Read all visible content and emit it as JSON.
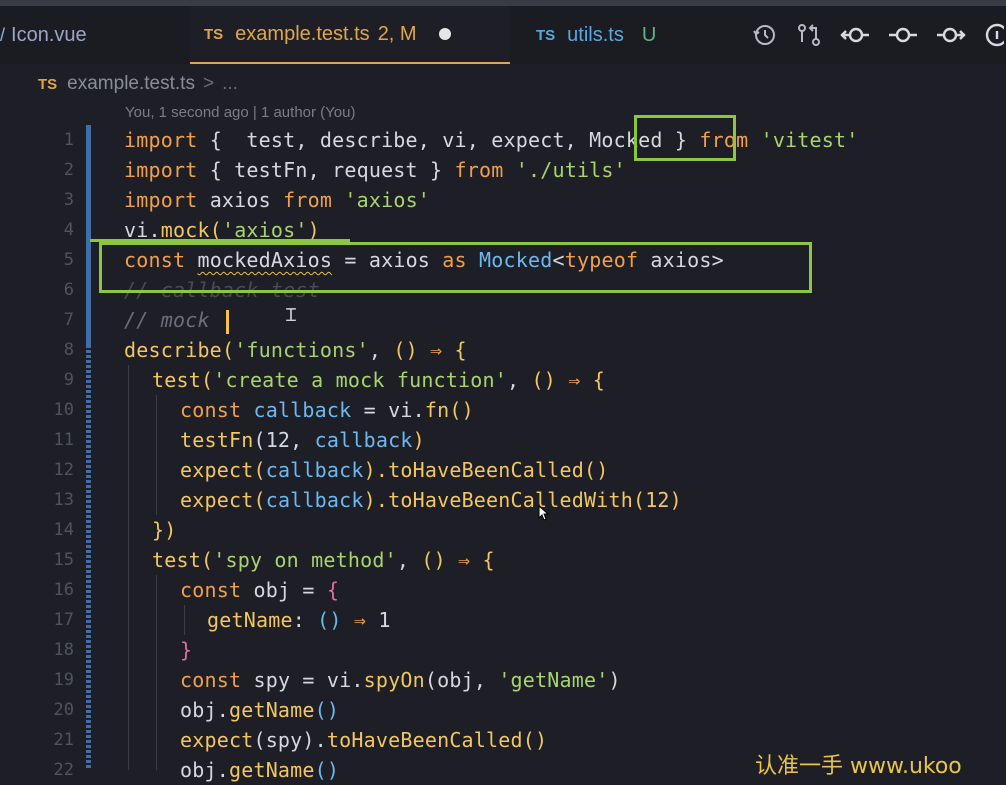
{
  "tabs": [
    {
      "label": "Icon.vue",
      "prefix": "",
      "status": "",
      "color": "#8ab4e8"
    },
    {
      "label": "example.test.ts",
      "prefix": "TS",
      "status": "2, M",
      "color": "#e0a64a",
      "active": true
    },
    {
      "label": "utils.ts",
      "prefix": "TS",
      "status": "U",
      "color": "#5aa7e0"
    }
  ],
  "tab_icons": [
    "history-icon",
    "git-compare-icon",
    "commit-prev-icon",
    "commit-icon",
    "commit-next-icon",
    "info-icon"
  ],
  "breadcrumb": {
    "prefix": "TS",
    "file": "example.test.ts",
    "sep": ">",
    "rest": "..."
  },
  "blame": "You, 1 second ago | 1 author (You)",
  "line_numbers": [
    "1",
    "2",
    "3",
    "4",
    "5",
    "6",
    "7",
    "8",
    "9",
    "10",
    "11",
    "12",
    "13",
    "14",
    "15",
    "16",
    "17",
    "18",
    "19",
    "20",
    "21",
    "22"
  ],
  "code": {
    "l1": {
      "a": "import",
      "b": " {  test, describe, vi, expect, ",
      "c": "Mocked",
      "d": " } ",
      "e": "from",
      "f": " ",
      "g": "'vitest'"
    },
    "l2": {
      "a": "import",
      "b": " { testFn, request } ",
      "c": "from",
      "d": " ",
      "e": "'./utils'"
    },
    "l3": {
      "a": "import",
      "b": " axios ",
      "c": "from",
      "d": " ",
      "e": "'axios'"
    },
    "l4": {
      "a": "vi.",
      "b": "mock",
      "c": "(",
      "d": "'axios'",
      "e": ")"
    },
    "l5": {
      "a": "const",
      "b": " ",
      "c": "mockedAxios",
      "d": " = axios ",
      "e": "as",
      "f": " ",
      "g": "Mocked",
      "h": "<",
      "i": "typeof",
      "j": " axios>"
    },
    "l6": {
      "a": "// callback test"
    },
    "l7": {
      "a": "// mock "
    },
    "l8": {
      "a": "describe",
      "b": "(",
      "c": "'functions'",
      "d": ", ",
      "e": "()",
      "f": " ⇒ ",
      "g": "{"
    },
    "l9": {
      "a": "test",
      "b": "(",
      "c": "'create a mock function'",
      "d": ", ",
      "e": "()",
      "f": " ⇒ ",
      "g": "{"
    },
    "l10": {
      "a": "const",
      "b": " ",
      "c": "callback",
      "d": " = vi.",
      "e": "fn",
      "f": "()"
    },
    "l11": {
      "a": "testFn",
      "b": "(12, ",
      "c": "callback",
      "d": ")"
    },
    "l12": {
      "a": "expect",
      "b": "(",
      "c": "callback",
      "d": ").",
      "e": "toHaveBeenCalled",
      "f": "()"
    },
    "l13": {
      "a": "expect",
      "b": "(",
      "c": "callback",
      "d": ").",
      "e": "toHaveBeenCalledWith",
      "f": "(12)"
    },
    "l14": {
      "a": "})"
    },
    "l15": {
      "a": "test",
      "b": "(",
      "c": "'spy on method'",
      "d": ", ",
      "e": "()",
      "f": " ⇒ ",
      "g": "{"
    },
    "l16": {
      "a": "const",
      "b": " obj = ",
      "c": "{"
    },
    "l17": {
      "a": "getName",
      "b": ": ",
      "c": "()",
      "d": " ⇒ ",
      "e": "1"
    },
    "l18": {
      "a": "}"
    },
    "l19": {
      "a": "const",
      "b": " spy = vi.",
      "c": "spyOn",
      "d": "(obj, ",
      "e": "'getName'",
      "f": ")"
    },
    "l20": {
      "a": "obj.",
      "b": "getName",
      "c": "()"
    },
    "l21": {
      "a": "expect",
      "b": "(spy).",
      "c": "toHaveBeenCalled",
      "d": "()"
    },
    "l22": {
      "a": "obj.",
      "b": "getName",
      "c": "()"
    }
  },
  "watermark": "认准一手 www.ukoo",
  "colors": {
    "keyword": "#f0a04a",
    "string": "#a7d46f",
    "function": "#f2c661",
    "variable": "#6cb8f0",
    "highlight": "#8dc63f"
  }
}
